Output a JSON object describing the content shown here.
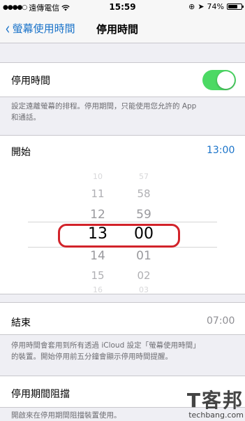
{
  "status_bar": {
    "carrier": "遠傳電信",
    "time": "15:59",
    "battery": "74%",
    "battery_level": 0.74
  },
  "nav": {
    "back_label": "螢幕使用時間",
    "title": "停用時間"
  },
  "downtime": {
    "label": "停用時間",
    "enabled": true,
    "footnote_line1": "設定遠離螢幕的排程。停用期間，只能使用您允許的 App",
    "footnote_line2": "和通話。"
  },
  "start": {
    "label": "開始",
    "value": "13:00"
  },
  "picker": {
    "hours": [
      "10",
      "11",
      "12",
      "13",
      "14",
      "15",
      "16"
    ],
    "minutes": [
      "57",
      "58",
      "59",
      "00",
      "01",
      "02",
      "03"
    ],
    "selected_index": 3
  },
  "end": {
    "label": "結束",
    "value": "07:00",
    "footnote_line1": "停用時間會套用到所有透過 iCloud 設定「螢幕使用時間」",
    "footnote_line2": "的裝置。開始停用前五分鐘會顯示停用時間提醒。"
  },
  "block": {
    "label": "停用期間阻擋",
    "footnote": "開啟來在停用期間阻擋裝置使用。"
  },
  "watermark": {
    "big": "T客邦",
    "small": "techbang.com"
  },
  "colors": {
    "accent": "#1a73c9",
    "toggle_on": "#4cd964",
    "highlight": "#d2232a"
  }
}
